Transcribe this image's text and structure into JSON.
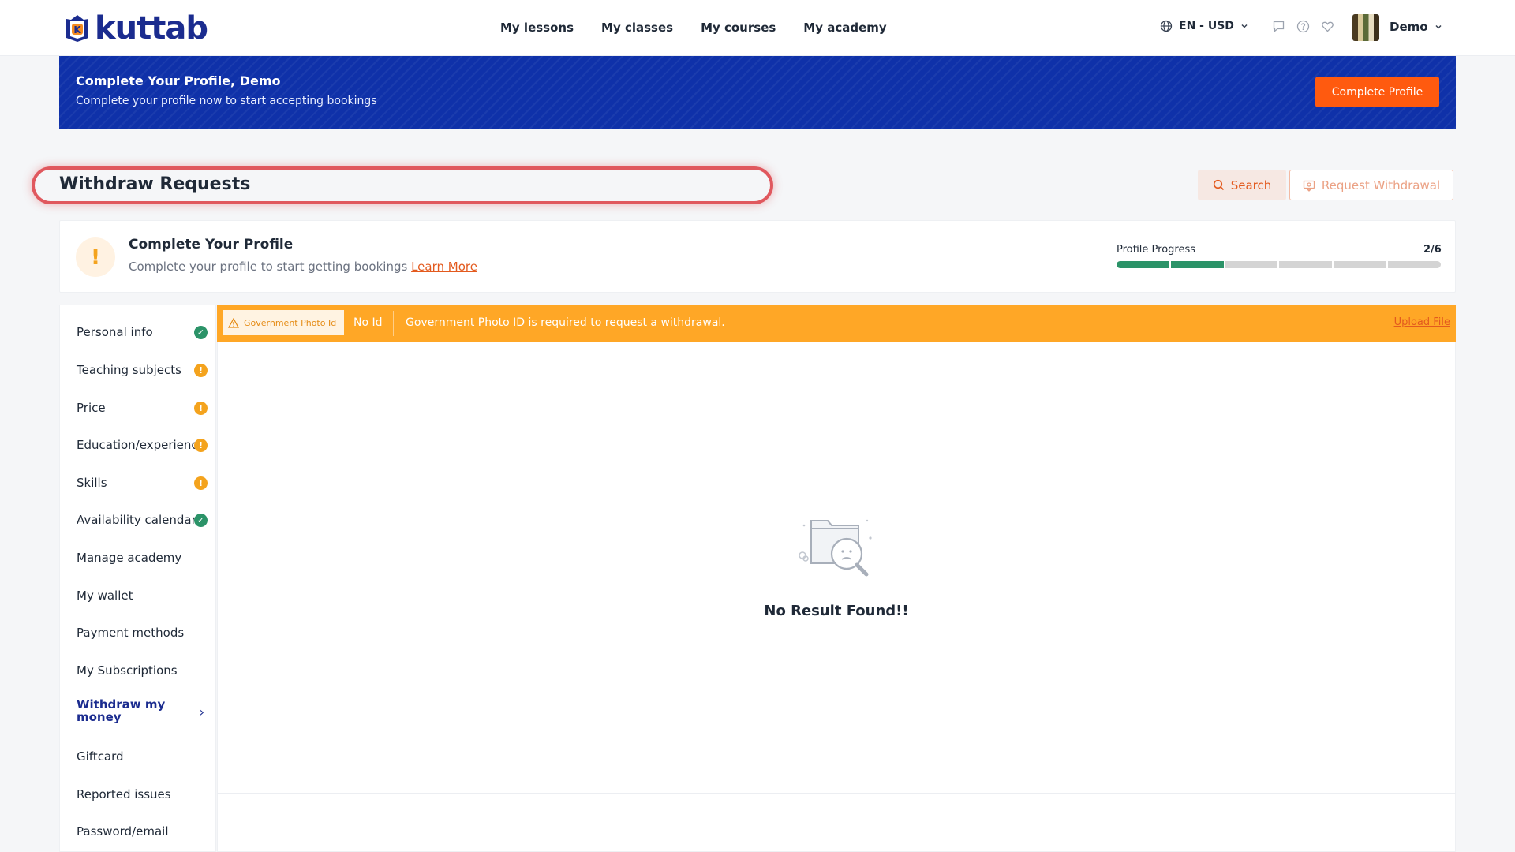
{
  "header": {
    "logo_text": "kuttab",
    "nav": [
      "My lessons",
      "My classes",
      "My courses",
      "My academy"
    ],
    "language": "EN - USD",
    "user_name": "Demo"
  },
  "banner": {
    "title": "Complete Your Profile, Demo",
    "subtitle": "Complete your profile now to start accepting bookings",
    "button": "Complete Profile"
  },
  "page": {
    "title": "Withdraw Requests",
    "search_button": "Search",
    "withdraw_button": "Request Withdrawal"
  },
  "profile_card": {
    "title": "Complete Your Profile",
    "subtitle": "Complete your profile to start getting bookings",
    "learn_more": "Learn More",
    "progress_label": "Profile Progress",
    "progress_count": "2/6",
    "progress_completed": 2,
    "progress_total": 6
  },
  "sidebar": {
    "items": [
      {
        "label": "Personal info",
        "status": "ok"
      },
      {
        "label": "Teaching subjects",
        "status": "warn"
      },
      {
        "label": "Price",
        "status": "warn"
      },
      {
        "label": "Education/experience",
        "status": "warn"
      },
      {
        "label": "Skills",
        "status": "warn"
      },
      {
        "label": "Availability calendar",
        "status": "ok"
      },
      {
        "label": "Manage academy",
        "status": ""
      },
      {
        "label": "My wallet",
        "status": ""
      },
      {
        "label": "Payment methods",
        "status": ""
      },
      {
        "label": "My Subscriptions",
        "status": ""
      },
      {
        "label": "Withdraw my money",
        "status": "active"
      },
      {
        "label": "Giftcard",
        "status": ""
      },
      {
        "label": "Reported issues",
        "status": ""
      },
      {
        "label": "Password/email",
        "status": ""
      }
    ]
  },
  "alert": {
    "tag": "Government Photo Id",
    "status": "No Id",
    "message": "Government Photo ID is required to request a withdrawal.",
    "link": "Upload File"
  },
  "empty_state": {
    "text": "No Result Found!!"
  },
  "colors": {
    "brand_blue": "#0f31a9",
    "accent_orange": "#ff5a0f",
    "success_green": "#2b9368",
    "warning_amber": "#ffa726"
  }
}
